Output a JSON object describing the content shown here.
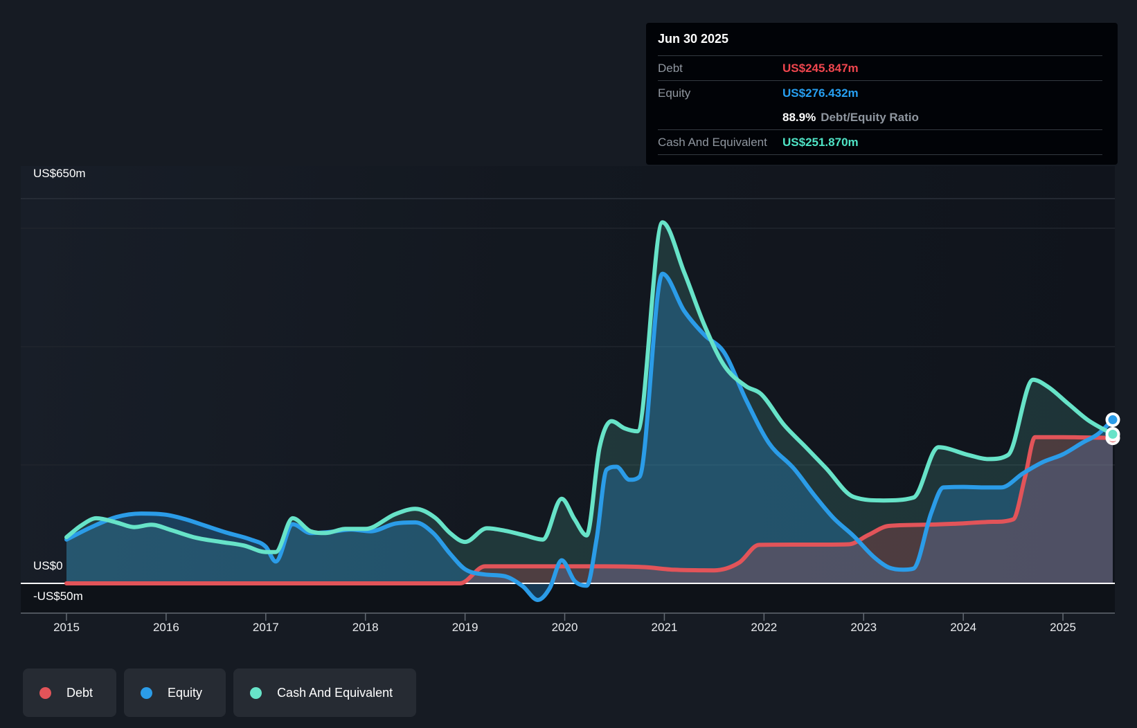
{
  "colors": {
    "debt": "#e25459",
    "equity": "#2b9ce8",
    "cash": "#67e3c8",
    "debt_text": "#f0464e",
    "equity_text": "#27a0f2",
    "cash_text": "#4fe4c6",
    "zero_line": "#ffffff",
    "grid_minor": "#20252d",
    "grid_top": "#2a303a",
    "axis_line": "#636a73",
    "label_gray": "#8f969f"
  },
  "y_axis": {
    "top_label": "US$650m",
    "zero_label": "US$0",
    "bottom_label": "-US$50m"
  },
  "x_axis": {
    "years": [
      "2015",
      "2016",
      "2017",
      "2018",
      "2019",
      "2020",
      "2021",
      "2022",
      "2023",
      "2024",
      "2025"
    ]
  },
  "tooltip": {
    "date": "Jun 30 2025",
    "rows": [
      {
        "label": "Debt",
        "value": "US$245.847m",
        "color_key": "debt_text"
      },
      {
        "label": "Equity",
        "value": "US$276.432m",
        "color_key": "equity_text"
      },
      {
        "label": "Cash And Equivalent",
        "value": "US$251.870m",
        "color_key": "cash_text"
      }
    ],
    "ratio_value": "88.9%",
    "ratio_label": "Debt/Equity Ratio"
  },
  "legend": [
    {
      "label": "Debt",
      "color_key": "debt"
    },
    {
      "label": "Equity",
      "color_key": "equity"
    },
    {
      "label": "Cash And Equivalent",
      "color_key": "cash"
    }
  ],
  "chart_data": {
    "type": "area",
    "x_unit": "decimal_year",
    "y_unit": "US$ millions",
    "xlim": [
      2015.0,
      2025.5
    ],
    "ylim": [
      -50,
      650
    ],
    "gridlines_m": [
      650,
      600,
      400,
      200,
      0,
      -50
    ],
    "grid": "horizontal-only",
    "legend_position": "bottom-left",
    "series": [
      {
        "name": "Debt",
        "color_key": "debt",
        "fill_opacity": 0.24,
        "points": [
          [
            2015.0,
            0
          ],
          [
            2016.0,
            0
          ],
          [
            2017.0,
            0
          ],
          [
            2018.0,
            0
          ],
          [
            2018.95,
            0
          ],
          [
            2019.2,
            28.8
          ],
          [
            2019.6,
            28.8
          ],
          [
            2020.0,
            28.8
          ],
          [
            2020.4,
            28.8
          ],
          [
            2020.8,
            27.5
          ],
          [
            2021.1,
            23
          ],
          [
            2021.5,
            22
          ],
          [
            2021.75,
            35
          ],
          [
            2021.95,
            65
          ],
          [
            2022.3,
            65.5
          ],
          [
            2022.6,
            65.5
          ],
          [
            2022.85,
            66
          ],
          [
            2023.05,
            82
          ],
          [
            2023.25,
            97
          ],
          [
            2023.6,
            99
          ],
          [
            2023.95,
            101
          ],
          [
            2024.3,
            104
          ],
          [
            2024.5,
            108
          ],
          [
            2024.62,
            180
          ],
          [
            2024.72,
            247
          ],
          [
            2025.0,
            247
          ],
          [
            2025.2,
            246.5
          ],
          [
            2025.5,
            245.847
          ]
        ]
      },
      {
        "name": "Equity",
        "color_key": "equity",
        "fill_opacity": 0.28,
        "points": [
          [
            2015.0,
            74
          ],
          [
            2015.25,
            95
          ],
          [
            2015.5,
            112
          ],
          [
            2015.75,
            118
          ],
          [
            2016.0,
            116
          ],
          [
            2016.2,
            108
          ],
          [
            2016.4,
            97
          ],
          [
            2016.6,
            86
          ],
          [
            2016.85,
            74
          ],
          [
            2017.0,
            62
          ],
          [
            2017.1,
            37
          ],
          [
            2017.27,
            100
          ],
          [
            2017.45,
            85
          ],
          [
            2017.65,
            87
          ],
          [
            2017.85,
            91
          ],
          [
            2018.05,
            88
          ],
          [
            2018.3,
            101
          ],
          [
            2018.5,
            103
          ],
          [
            2018.68,
            85
          ],
          [
            2018.85,
            50
          ],
          [
            2019.0,
            24
          ],
          [
            2019.2,
            15
          ],
          [
            2019.4,
            12
          ],
          [
            2019.58,
            -5
          ],
          [
            2019.73,
            -28
          ],
          [
            2019.85,
            -8
          ],
          [
            2019.97,
            39
          ],
          [
            2020.1,
            4
          ],
          [
            2020.22,
            -4
          ],
          [
            2020.32,
            75
          ],
          [
            2020.42,
            192
          ],
          [
            2020.52,
            197
          ],
          [
            2020.65,
            175
          ],
          [
            2020.75,
            180
          ],
          [
            2020.98,
            523
          ],
          [
            2021.2,
            460
          ],
          [
            2021.4,
            420
          ],
          [
            2021.6,
            390
          ],
          [
            2021.82,
            310
          ],
          [
            2022.05,
            237
          ],
          [
            2022.3,
            194
          ],
          [
            2022.5,
            150
          ],
          [
            2022.7,
            110
          ],
          [
            2022.9,
            80
          ],
          [
            2023.1,
            45
          ],
          [
            2023.25,
            27
          ],
          [
            2023.4,
            23
          ],
          [
            2023.5,
            25
          ],
          [
            2023.68,
            120
          ],
          [
            2023.8,
            162
          ],
          [
            2024.0,
            163
          ],
          [
            2024.2,
            162
          ],
          [
            2024.38,
            162
          ],
          [
            2024.6,
            186
          ],
          [
            2024.8,
            205
          ],
          [
            2025.0,
            218
          ],
          [
            2025.2,
            238
          ],
          [
            2025.35,
            252
          ],
          [
            2025.5,
            276.432
          ]
        ]
      },
      {
        "name": "Cash And Equivalent",
        "color_key": "cash",
        "fill_opacity": 0.16,
        "points": [
          [
            2015.0,
            78
          ],
          [
            2015.15,
            98
          ],
          [
            2015.3,
            110
          ],
          [
            2015.5,
            103
          ],
          [
            2015.68,
            95
          ],
          [
            2015.85,
            99
          ],
          [
            2016.05,
            90
          ],
          [
            2016.3,
            77
          ],
          [
            2016.55,
            70
          ],
          [
            2016.78,
            64
          ],
          [
            2017.0,
            53
          ],
          [
            2017.1,
            53
          ],
          [
            2017.27,
            110
          ],
          [
            2017.45,
            88
          ],
          [
            2017.6,
            85
          ],
          [
            2017.8,
            92
          ],
          [
            2018.0,
            92
          ],
          [
            2018.3,
            117
          ],
          [
            2018.5,
            126
          ],
          [
            2018.7,
            111
          ],
          [
            2018.85,
            85
          ],
          [
            2019.0,
            70
          ],
          [
            2019.22,
            93
          ],
          [
            2019.4,
            89
          ],
          [
            2019.6,
            81
          ],
          [
            2019.78,
            74
          ],
          [
            2019.97,
            143
          ],
          [
            2020.1,
            108
          ],
          [
            2020.22,
            81
          ],
          [
            2020.35,
            230
          ],
          [
            2020.47,
            274
          ],
          [
            2020.6,
            262
          ],
          [
            2020.73,
            257
          ],
          [
            2020.98,
            610
          ],
          [
            2021.2,
            525
          ],
          [
            2021.4,
            437
          ],
          [
            2021.6,
            368
          ],
          [
            2021.82,
            333
          ],
          [
            2021.97,
            320
          ],
          [
            2022.2,
            268
          ],
          [
            2022.42,
            230
          ],
          [
            2022.62,
            195
          ],
          [
            2022.9,
            146
          ],
          [
            2023.2,
            140
          ],
          [
            2023.5,
            145
          ],
          [
            2023.75,
            230
          ],
          [
            2024.05,
            217
          ],
          [
            2024.25,
            210
          ],
          [
            2024.45,
            217
          ],
          [
            2024.7,
            344
          ],
          [
            2024.85,
            332
          ],
          [
            2025.05,
            304
          ],
          [
            2025.25,
            276
          ],
          [
            2025.5,
            251.87
          ]
        ]
      }
    ],
    "end_markers": [
      {
        "series": "Debt",
        "x": 2025.5,
        "value": 245.847
      },
      {
        "series": "Cash And Equivalent",
        "x": 2025.5,
        "value": 251.87
      },
      {
        "series": "Equity",
        "x": 2025.5,
        "value": 276.432
      }
    ]
  }
}
